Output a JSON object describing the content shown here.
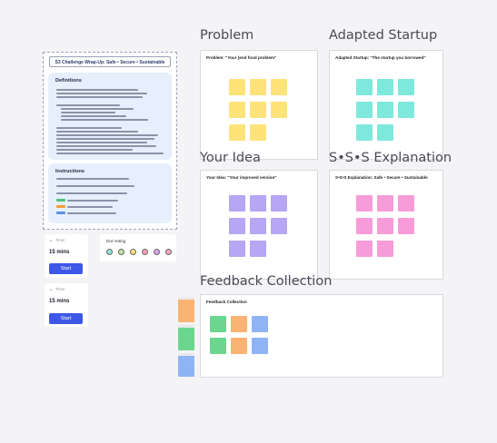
{
  "frames": {
    "problem": {
      "title": "Problem",
      "label": "Problem: \"Your (end food problem\""
    },
    "adapted": {
      "title": "Adapted Startup",
      "label": "Adapted Startup: \"The startup you borrowed\""
    },
    "idea": {
      "title": "Your Idea",
      "label": "Your Idea: \"Your improved version\""
    },
    "sss": {
      "title": "S•S•S Explanation",
      "label": "S•S•S Explanation: Safe • Secure • Sustainable"
    },
    "feedback": {
      "title": "Feedback Collection",
      "label": "Feedback Collection"
    }
  },
  "challenge": {
    "header": "S3 Challenge Wrap-Up: Safe • Secure • Sustainable",
    "definitions_title": "Definitions",
    "instructions_title": "Instructions"
  },
  "timers": [
    {
      "label": "Timer",
      "duration": "15 mins",
      "button": "Start"
    },
    {
      "label": "Timer",
      "duration": "15 mins",
      "button": "Start"
    }
  ],
  "dot_voting": {
    "title": "Dot Voting",
    "colors": [
      "#8ee6d6",
      "#bfe9a0",
      "#f7e27a",
      "#f7a3b5",
      "#d6a6f0",
      "#f0a6c8"
    ]
  },
  "colors": {
    "accent": "#3d57e6",
    "sticky_yellow": "#fde37a",
    "sticky_cyan": "#7fe8dd",
    "sticky_purple": "#b6a6f3",
    "sticky_pink": "#f79cd8",
    "sticky_green": "#6ad68e",
    "sticky_orange": "#fbb373",
    "sticky_blue": "#8fb4f5"
  }
}
